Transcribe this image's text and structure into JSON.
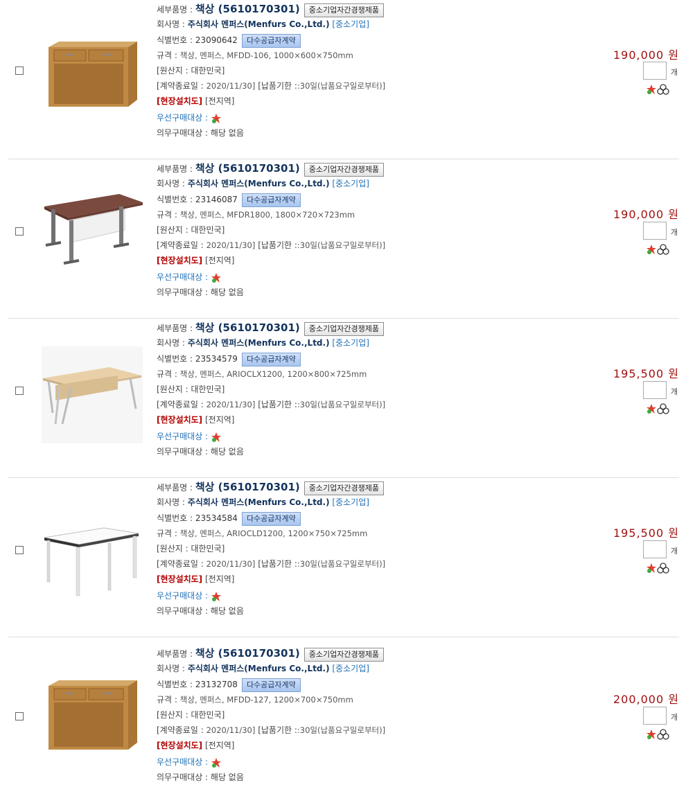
{
  "labels": {
    "product_name": "세부품명 :",
    "company": "회사명 :",
    "id": "식별번호 :",
    "spec": "규격 :",
    "origin": "[원산지 : 대한민국]",
    "contract_end": "[계약종료일 :",
    "delivery": "[납품기한 :",
    "install": "[현장설치도]",
    "install_region": "[전지역]",
    "priority": "우선구매대상 :",
    "mandatory": "의무구매대상 : 해당 없음",
    "sme_btn": "중소기업자간경쟁제품",
    "mas_btn": "다수공급자계약",
    "company_name": "주식회사 멘퍼스(Menfurs Co.,Ltd.)",
    "company_type": "[중소기업]",
    "contract_date": "2020/11/30]",
    "delivery_terms": ":30일(납품요구일로부터)]",
    "unit": "개",
    "currency": "원"
  },
  "items": [
    {
      "product": "책상 (5610170301)",
      "id": "23090642",
      "spec": "책상, 멘퍼스, MFDD-106, 1000×600×750mm",
      "price": "190,000",
      "image": "wood-desk-drawers"
    },
    {
      "product": "책상 (5610170301)",
      "id": "23146087",
      "spec": "책상, 멘퍼스, MFDR1800, 1800×720×723mm",
      "price": "190,000",
      "image": "steel-desk-mahogany-top"
    },
    {
      "product": "책상 (5610170301)",
      "id": "23534579",
      "spec": "책상, 멘퍼스, ARIOCLX1200, 1200×800×725mm",
      "price": "195,500",
      "image": "light-oak-desk-a-legs"
    },
    {
      "product": "책상 (5610170301)",
      "id": "23534584",
      "spec": "책상, 멘퍼스, ARIOCLD1200, 1200×750×725mm",
      "price": "195,500",
      "image": "white-desk-steel-legs"
    },
    {
      "product": "책상 (5610170301)",
      "id": "23132708",
      "spec": "책상, 멘퍼스, MFDD-127, 1200×700×750mm",
      "price": "200,000",
      "image": "wood-desk-drawers"
    }
  ]
}
